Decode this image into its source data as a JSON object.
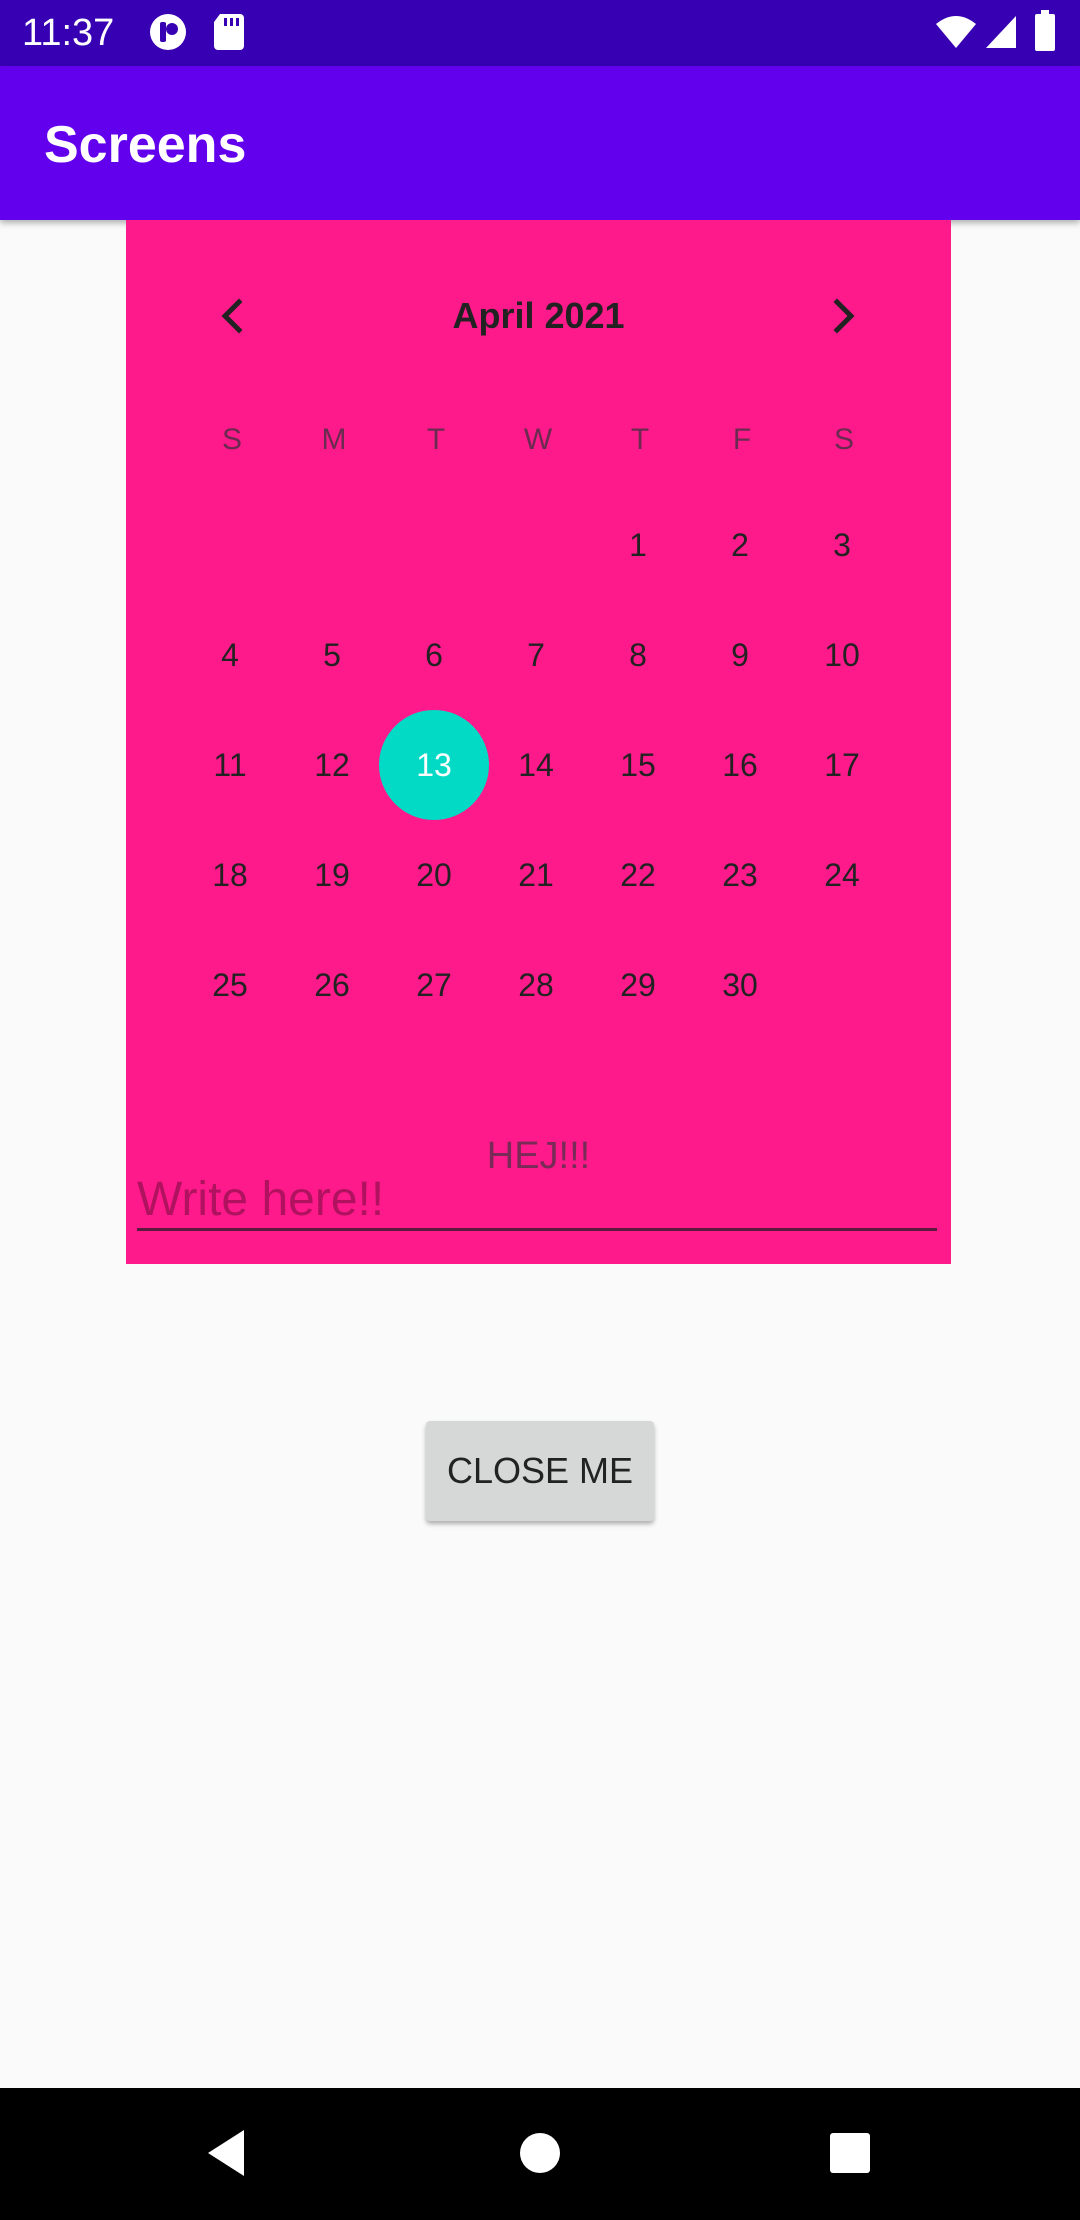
{
  "status_bar": {
    "time": "11:37",
    "left_icons": [
      "notification-app-icon",
      "sd-card-icon"
    ],
    "right_icons": [
      "wifi-icon",
      "signal-icon",
      "battery-icon"
    ]
  },
  "app_bar": {
    "title": "Screens"
  },
  "calendar": {
    "month_label": "April 2021",
    "prev_icon": "chevron-left-icon",
    "next_icon": "chevron-right-icon",
    "weekdays": [
      "S",
      "M",
      "T",
      "W",
      "T",
      "F",
      "S"
    ],
    "days": [
      "1",
      "2",
      "3",
      "4",
      "5",
      "6",
      "7",
      "8",
      "9",
      "10",
      "11",
      "12",
      "13",
      "14",
      "15",
      "16",
      "17",
      "18",
      "19",
      "20",
      "21",
      "22",
      "23",
      "24",
      "25",
      "26",
      "27",
      "28",
      "29",
      "30"
    ],
    "selected_day": "13",
    "background_color": "#FF1A8C",
    "selected_color": "#03DAC5"
  },
  "label": "HEJ!!!",
  "input": {
    "placeholder": "Write here!!",
    "value": ""
  },
  "close_button": {
    "label": "CLOSE ME"
  },
  "nav_bar": {
    "icons": [
      "back-icon",
      "home-icon",
      "recents-icon"
    ]
  },
  "colors": {
    "status_bar": "#3700B3",
    "app_bar": "#6200EE",
    "page_background": "#FAFAFA"
  }
}
